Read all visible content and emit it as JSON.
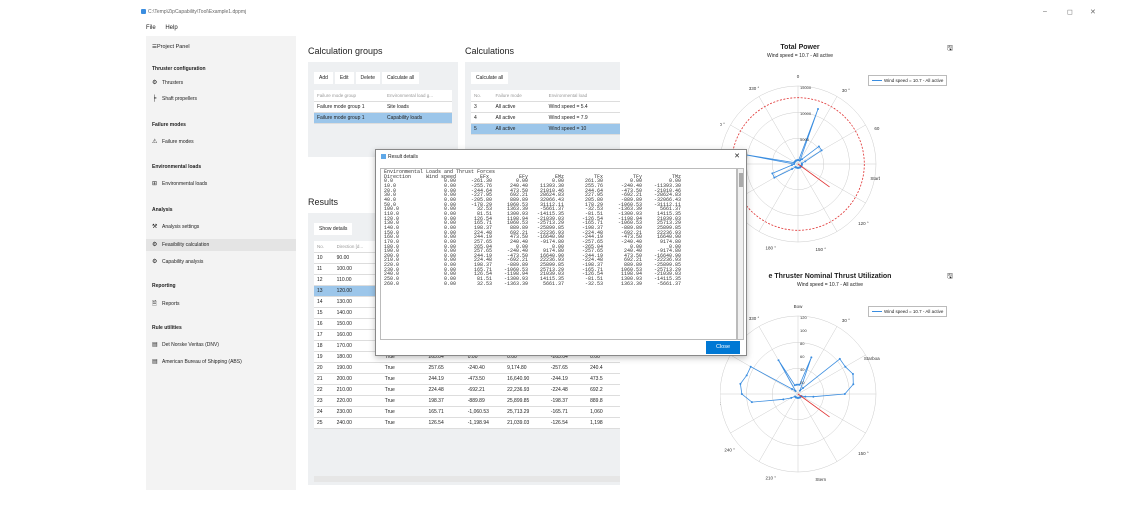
{
  "window": {
    "title": "C:\\Temp\\ZipCapability\\Tool\\Example1.dppmj",
    "min": "–",
    "max": "◻",
    "close": "✕"
  },
  "menu": [
    "File",
    "Help"
  ],
  "sidebar": {
    "header": "Project Panel",
    "sections": [
      {
        "title": "Thruster configuration",
        "items": [
          "Thrusters",
          "Shaft propellers"
        ]
      },
      {
        "title": "Failure modes",
        "items": [
          "Failure modes"
        ]
      },
      {
        "title": "Environmental loads",
        "items": [
          "Environmental loads"
        ]
      },
      {
        "title": "Analysis",
        "items": [
          "Analysis settings",
          "Feasibility calculation",
          "Capability analysis"
        ]
      },
      {
        "title": "Reporting",
        "items": [
          "Reports"
        ]
      },
      {
        "title": "Rule utilities",
        "items": [
          "Det Norske Veritas (DNV)",
          "American Bureau of Shipping (ABS)"
        ]
      }
    ]
  },
  "calc_groups": {
    "title": "Calculation groups",
    "buttons": [
      "Add",
      "Edit",
      "Delete",
      "Calculate all"
    ],
    "headers": [
      "Failure mode group",
      "Environmental load g..."
    ],
    "rows": [
      [
        "Failure mode group 1",
        "Site loads"
      ],
      [
        "Failure mode group 1",
        "Capability loads"
      ]
    ]
  },
  "calculations": {
    "title": "Calculations",
    "button": "Calculate all",
    "headers": [
      "No.",
      "Failure mode",
      "Environmental load"
    ],
    "rows": [
      [
        "3",
        "All active",
        "Wind speed = 5.4"
      ],
      [
        "4",
        "All active",
        "Wind speed = 7.9"
      ],
      [
        "5",
        "All active",
        "Wind speed = 10"
      ]
    ]
  },
  "results": {
    "title": "Results",
    "button": "Show details",
    "headers": [
      "No.",
      "Direction [d..."
    ],
    "rows": [
      [
        "10",
        "90.00",
        "",
        "",
        "",
        "",
        "",
        ""
      ],
      [
        "11",
        "100.00",
        "",
        "",
        "",
        "",
        "",
        ""
      ],
      [
        "12",
        "110.00",
        "",
        "",
        "",
        "",
        "",
        ""
      ],
      [
        "13",
        "120.00",
        "",
        "",
        "",
        "",
        "",
        ""
      ],
      [
        "14",
        "130.00",
        "",
        "",
        "",
        "",
        "",
        ""
      ],
      [
        "15",
        "140.00",
        "",
        "",
        "",
        "",
        "",
        ""
      ],
      [
        "16",
        "150.00",
        "",
        "",
        "",
        "",
        "",
        ""
      ],
      [
        "17",
        "160.00",
        "True",
        "244.19",
        "473.50",
        "-16,640.90",
        "-244.19",
        "-473."
      ],
      [
        "18",
        "170.00",
        "True",
        "257.65",
        "240.40",
        "-9,174.80",
        "-257.65",
        "-240."
      ],
      [
        "19",
        "180.00",
        "True",
        "265.04",
        "0.00",
        "0.00",
        "-265.04",
        "0.00"
      ],
      [
        "20",
        "190.00",
        "True",
        "257.65",
        "-240.40",
        "9,174.80",
        "-257.65",
        "240.4"
      ],
      [
        "21",
        "200.00",
        "True",
        "244.19",
        "-473.50",
        "16,640.90",
        "-244.19",
        "473.5"
      ],
      [
        "22",
        "210.00",
        "True",
        "224.48",
        "-692.21",
        "22,236.93",
        "-224.48",
        "692.2"
      ],
      [
        "23",
        "220.00",
        "True",
        "198.37",
        "-889.89",
        "25,899.85",
        "-198.37",
        "889.8"
      ],
      [
        "24",
        "230.00",
        "True",
        "165.71",
        "-1,060.53",
        "25,713.29",
        "-165.71",
        "1,060"
      ],
      [
        "25",
        "240.00",
        "True",
        "126.54",
        "-1,198.94",
        "21,039.03",
        "-126.54",
        "1,198"
      ]
    ]
  },
  "dialog": {
    "title": "Result details",
    "close": "Close",
    "lines": [
      "Environmental Loads and Thrust Forces",
      "Direction     Wind speed        EFx          EFy         EMz          TFx          TFy          TMz",
      "0.0                 0.00     -261.30        0.00        0.00       261.30         0.00         0.00",
      "10.0                0.00     -255.76      240.40    11393.30       255.76      -240.40    -11393.30",
      "20.0                0.00     -244.64      473.50    21010.46       244.64      -473.50    -21010.46",
      "30.0                0.00     -227.95      692.21    28624.83       227.95      -692.21    -28624.83",
      "40.0                0.00     -205.80      889.89    32066.43       205.80      -889.89    -32066.43",
      "50.0                0.00     -178.29     1060.53    31112.11       178.29     -1060.53    -31112.11",
      "100.0               0.00       32.53     1363.39    -5661.37       -32.53     -1363.39      5661.37",
      "110.0               0.00       81.51     1300.93   -14115.35       -81.51     -1300.93     14115.35",
      "120.0               0.00      126.54     1198.94   -21039.03      -126.54     -1198.94     21039.03",
      "130.0               0.00      165.71     1060.53   -25713.29      -165.71     -1060.53     25713.29",
      "140.0               0.00      198.37      889.89   -25899.85      -198.37      -889.89     25899.85",
      "150.0               0.00      224.48      692.21   -22236.93      -224.48      -692.21     22236.93",
      "160.0               0.00      244.19      473.50   -16640.90      -244.19      -473.50     16640.90",
      "170.0               0.00      257.65      240.40    -9174.80      -257.65      -240.40      9174.80",
      "180.0               0.00      265.04        0.00        0.00      -265.04         0.00         0.00",
      "190.0               0.00      257.65     -240.40     9174.80      -257.65       240.40     -9174.80",
      "200.0               0.00      244.19     -473.50    16640.90      -244.19       473.50    -16640.90",
      "210.0               0.00      224.48     -692.21    22236.93      -224.48       692.21    -22236.93",
      "220.0               0.00      198.37     -889.89    25899.85      -198.37       889.89    -25899.85",
      "230.0               0.00      165.71    -1060.53    25713.29      -165.71      1060.53    -25713.29",
      "240.0               0.00      126.54    -1198.94    21039.03      -126.54      1198.94    -21039.03",
      "250.0               0.00       81.51    -1300.93    14115.35       -81.51      1300.93    -14115.35",
      "260.0               0.00       32.53    -1363.39     5661.37       -32.53      1363.39     -5661.37"
    ]
  },
  "chart_data": [
    {
      "type": "polar",
      "title": "Total Power",
      "subtitle": "Wind speed = 10.7 - All active",
      "legend": "Wind speed = 10.7 - All active",
      "radial_ticks": [
        "5000",
        "10000",
        "15000"
      ],
      "angle_labels": [
        "0",
        "30 °",
        "60 °",
        "Starboard 90 °",
        "120 °",
        "150 °",
        "180 °",
        "Stern",
        "Bow",
        "300 °",
        "330 °"
      ],
      "series_color": "#3a8de0",
      "limit_color": "#e03030",
      "values": [
        0.05,
        0.05,
        0.75,
        0.05,
        0.08,
        0.35,
        0.35,
        0.1,
        0.05,
        0.05,
        0.05,
        0.05,
        0.05,
        0.05,
        0.05,
        0.05,
        0.05,
        0.05,
        0.05,
        0.05,
        0.05,
        0.05,
        0.05,
        0.1,
        0.35,
        0.35,
        0.08,
        0.05,
        0.75,
        0.05,
        0.05,
        0.05,
        0.05,
        0.05,
        0.05,
        0.05
      ]
    },
    {
      "type": "polar",
      "title": "e Thruster Nominal Thrust Utilization",
      "subtitle": "Wind speed = 10.7 - All active",
      "legend": "Wind speed = 10.7 - All active",
      "radial_ticks": [
        "20",
        "40",
        "60",
        "80",
        "100",
        "120"
      ],
      "angle_labels": [
        "Bow",
        "30 °",
        "Starboard 90 °",
        "120 °",
        "150 °",
        "Stern",
        "210 °",
        "240 °",
        "270 ° Port",
        "300 °",
        "330 °"
      ],
      "series_color": "#3a8de0",
      "limit_color": "#e03030",
      "values": [
        0.12,
        0.12,
        0.5,
        0.05,
        0.1,
        0.7,
        0.7,
        0.75,
        0.72,
        0.6,
        0.2,
        0.1,
        0.05,
        0.05,
        0.05,
        0.05,
        0.05,
        0.05,
        0.05,
        0.05,
        0.05,
        0.05,
        0.05,
        0.05,
        0.1,
        0.2,
        0.6,
        0.72,
        0.75,
        0.7,
        0.7,
        0.1,
        0.05,
        0.5,
        0.12,
        0.12
      ]
    }
  ]
}
